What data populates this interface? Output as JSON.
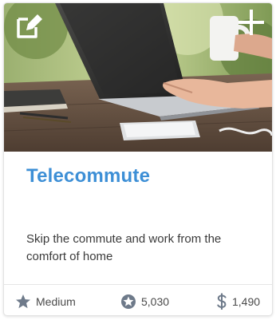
{
  "card": {
    "title": "Telecommute",
    "description": "Skip the commute and work from the comfort of home",
    "difficulty": "Medium",
    "points": "5,030",
    "cost": "1,490",
    "icons": {
      "edit": "edit-icon",
      "add": "plus-icon",
      "difficulty": "star-icon",
      "points": "star-badge-icon",
      "cost": "dollar-icon"
    }
  },
  "colors": {
    "title": "#3d8fd6",
    "text": "#3a3a3a",
    "icon": "#6e7a8a"
  }
}
